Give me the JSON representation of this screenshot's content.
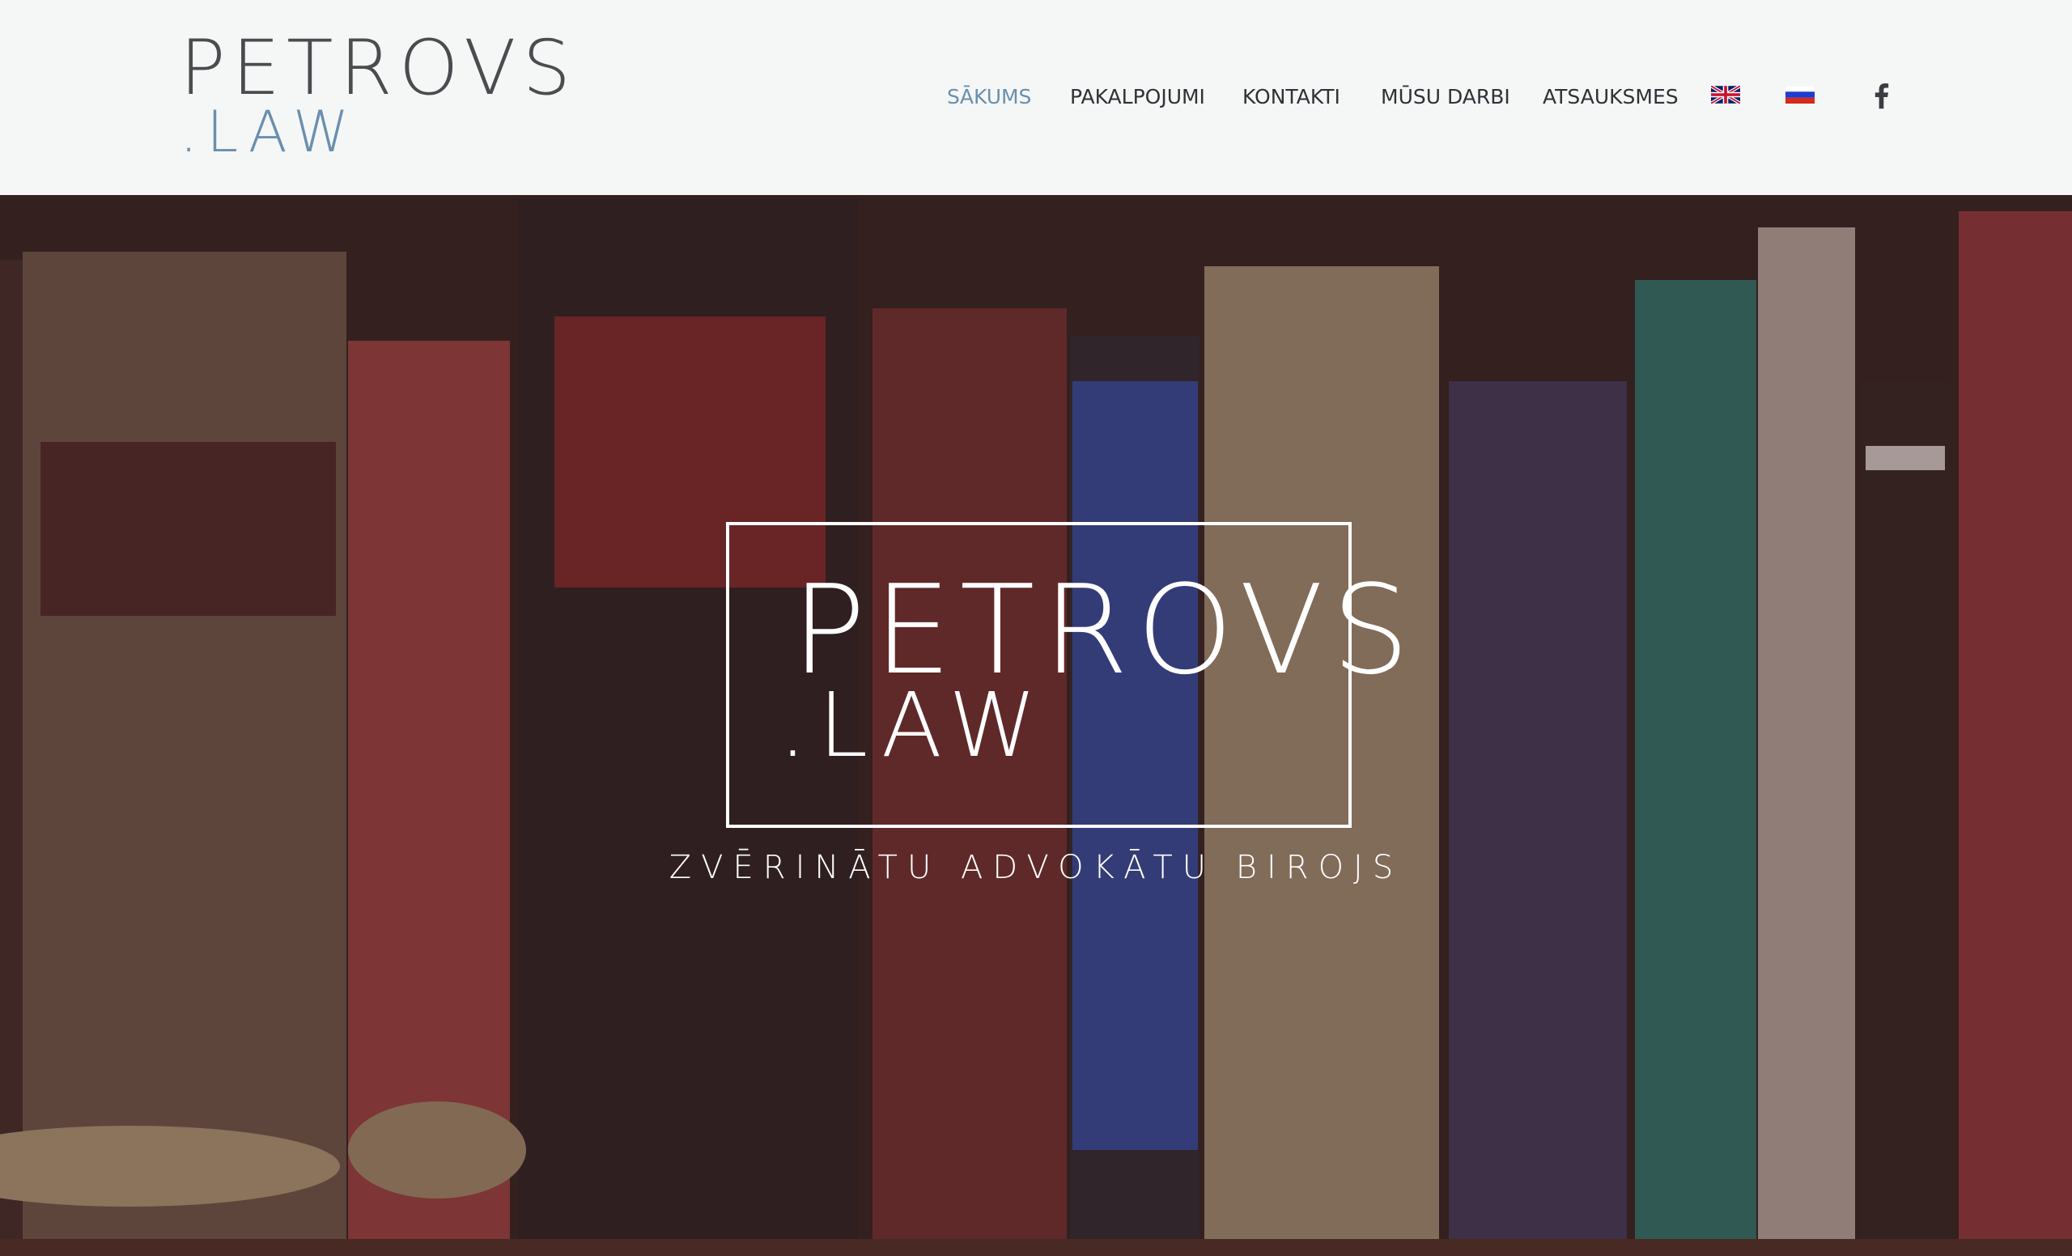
{
  "header": {
    "logo": {
      "main": "PETROVS",
      "sub": ".LAW"
    },
    "nav": [
      {
        "label": "SĀKUMS",
        "active": true
      },
      {
        "label": "PAKALPOJUMI",
        "active": false
      },
      {
        "label": "KONTAKTI",
        "active": false
      },
      {
        "label": "MŪSU DARBI",
        "active": false
      },
      {
        "label": "ATSAUKSMES",
        "active": false
      }
    ],
    "languages": [
      {
        "name": "English",
        "icon": "uk-flag-icon"
      },
      {
        "name": "Russian",
        "icon": "ru-flag-icon"
      }
    ],
    "social": {
      "icon": "facebook-icon"
    }
  },
  "hero": {
    "logo": {
      "main": "PETROVS",
      "sub": ".LAW"
    },
    "tagline": "ZVĒRINĀTU ADVOKĀTU BIROJS",
    "background": "bookshelf-photo"
  },
  "colors": {
    "accent": "#6a8fae",
    "nav_text": "#2f3236",
    "logo_text": "#4a4d50",
    "header_bg": "#f5f7f7"
  }
}
